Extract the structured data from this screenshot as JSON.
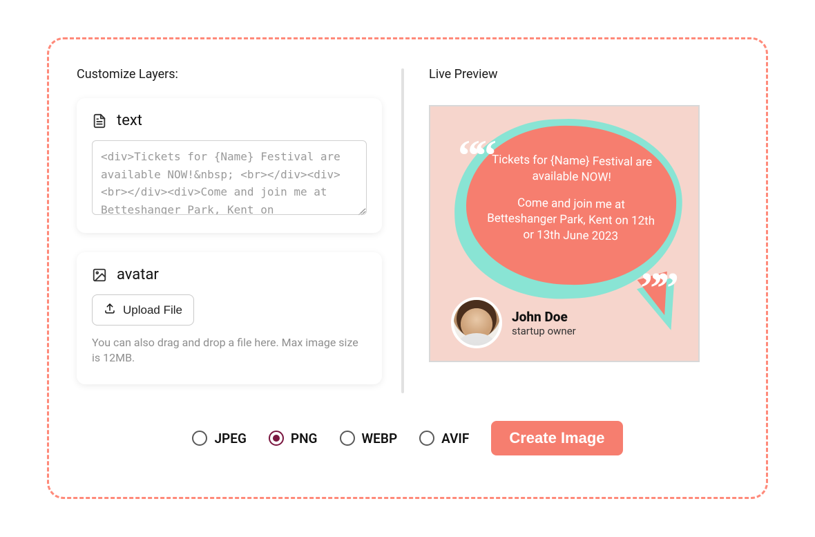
{
  "left": {
    "heading": "Customize Layers:",
    "text_card": {
      "title": "text",
      "value": "<div>Tickets for {Name} Festival are available NOW!&nbsp; <br></div><div><br></div><div>Come and join me at Betteshanger Park, Kent on"
    },
    "avatar_card": {
      "title": "avatar",
      "upload_label": "Upload File",
      "hint": "You can also drag and drop a file here. Max image size is 12MB."
    }
  },
  "right": {
    "heading": "Live Preview",
    "preview": {
      "line1": "Tickets for {Name} Festival are available NOW!",
      "line2": "Come and join me at Betteshanger Park, Kent on 12th or 13th June 2023",
      "person_name": "John Doe",
      "person_role": "startup owner"
    }
  },
  "formats": {
    "options": [
      "JPEG",
      "PNG",
      "WEBP",
      "AVIF"
    ],
    "selected": "PNG"
  },
  "create_label": "Create Image"
}
